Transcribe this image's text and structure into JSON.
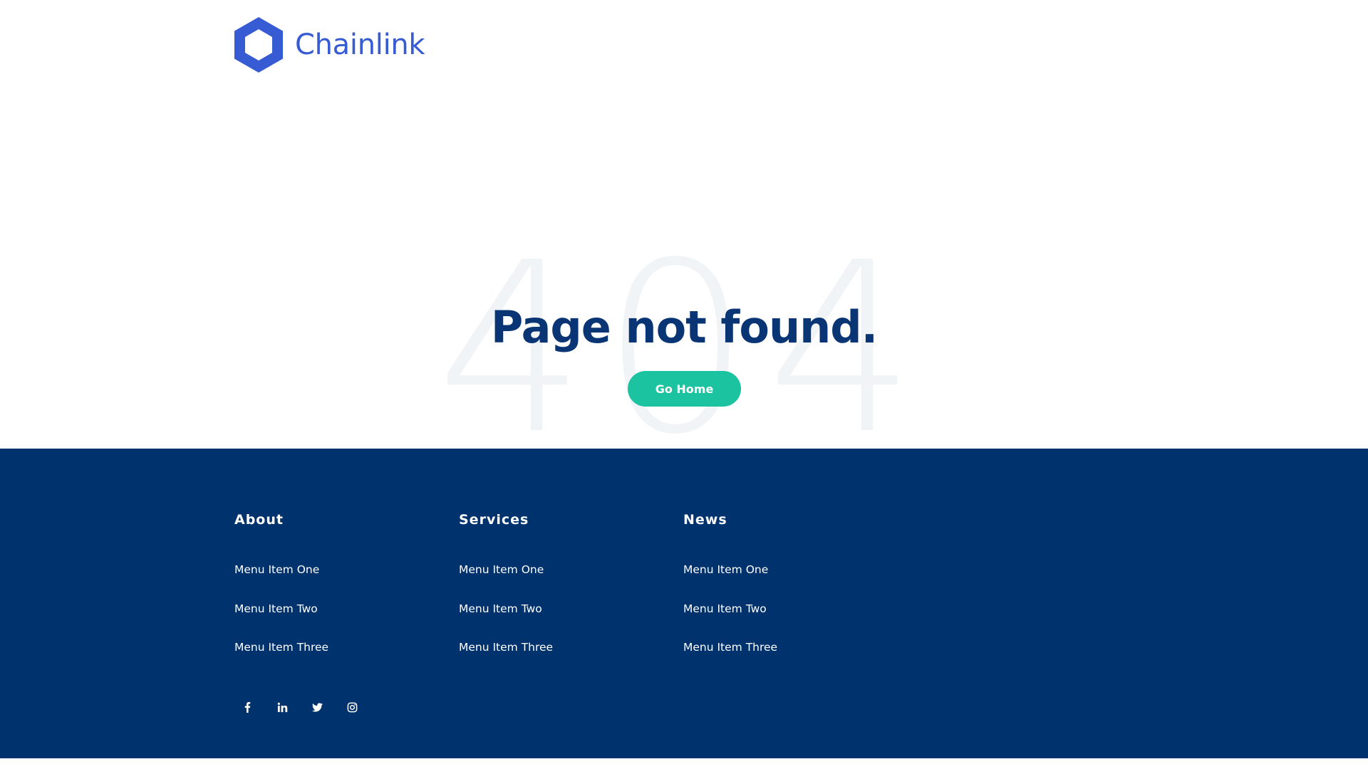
{
  "brand": {
    "name": "Chainlink",
    "color": "#375bd2"
  },
  "hero": {
    "background_number": "404",
    "title": "Page not found.",
    "button_label": "Go Home"
  },
  "footer": {
    "columns": [
      {
        "heading": "About",
        "items": [
          "Menu Item One",
          "Menu Item Two",
          "Menu Item Three"
        ]
      },
      {
        "heading": "Services",
        "items": [
          "Menu Item One",
          "Menu Item Two",
          "Menu Item Three"
        ]
      },
      {
        "heading": "News",
        "items": [
          "Menu Item One",
          "Menu Item Two",
          "Menu Item Three"
        ]
      }
    ],
    "social_icons": [
      "facebook-icon",
      "linkedin-icon",
      "twitter-icon",
      "instagram-icon"
    ]
  },
  "colors": {
    "title": "#0a3574",
    "button": "#1bc3a1",
    "footer_background": "#00336e",
    "background_number": "#f1f4f7"
  }
}
